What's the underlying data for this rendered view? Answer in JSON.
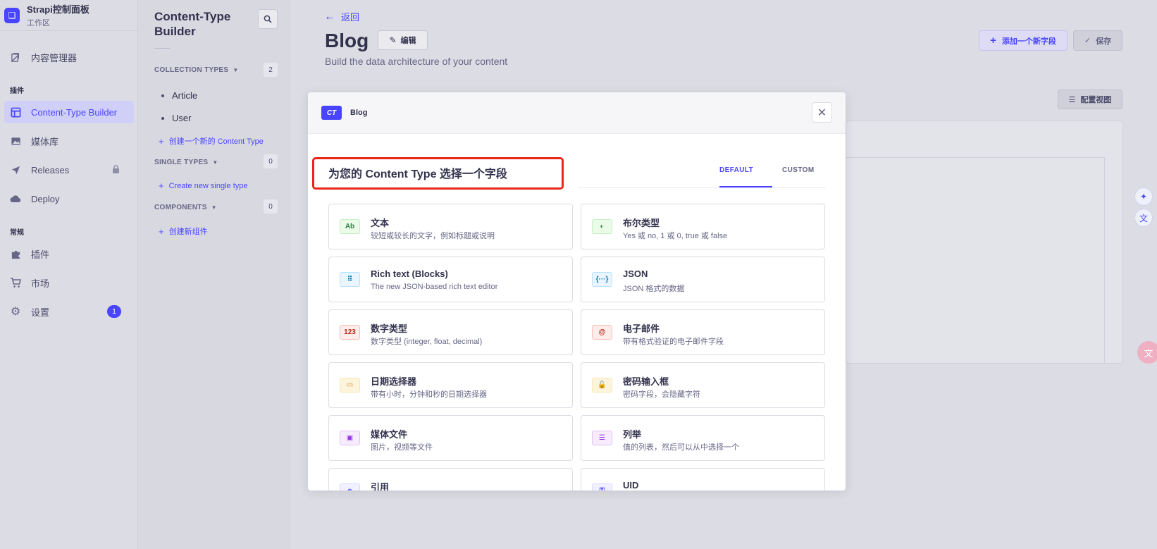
{
  "brand": {
    "logo_glyph": "❏",
    "title": "Strapi控制面板",
    "subtitle": "工作区"
  },
  "leftnav": {
    "content_manager": "内容管理器",
    "section_plugins": "插件",
    "ctb": "Content-Type Builder",
    "media": "媒体库",
    "releases": "Releases",
    "deploy": "Deploy",
    "section_general": "常规",
    "plugins": "插件",
    "marketplace": "市场",
    "settings": "设置",
    "settings_badge": "1"
  },
  "subnav": {
    "title": "Content-Type Builder",
    "collection_types": {
      "label": "COLLECTION TYPES",
      "count": "2",
      "items": [
        "Article",
        "User"
      ],
      "add": "创建一个新的 Content Type"
    },
    "single_types": {
      "label": "SINGLE TYPES",
      "count": "0",
      "add": "Create new single type"
    },
    "components": {
      "label": "COMPONENTS",
      "count": "0",
      "add": "创建新组件"
    }
  },
  "header": {
    "back": "返回",
    "title": "Blog",
    "edit": "编辑",
    "subtitle": "Build the data architecture of your content",
    "add_field": "添加一个新字段",
    "save": "保存",
    "configure_view": "配置视图"
  },
  "modal": {
    "chip": "CT",
    "name": "Blog",
    "pick_title": "为您的 Content Type 选择一个字段",
    "tab_default": "DEFAULT",
    "tab_custom": "CUSTOM",
    "fields": [
      {
        "name": "文本",
        "desc": "较短或较长的文字，例如标题或说明",
        "icon": "Ab",
        "icon_name": "text-icon",
        "bg": "#eafbe7",
        "fg": "#328048",
        "border": "#c6f0c2"
      },
      {
        "name": "布尔类型",
        "desc": "Yes 或 no, 1 或 0, true 或 false",
        "icon": "◐",
        "icon_name": "boolean-icon",
        "bg": "#eafbe7",
        "fg": "#328048",
        "border": "#c6f0c2"
      },
      {
        "name": "Rich text (Blocks)",
        "desc": "The new JSON-based rich text editor",
        "icon": "⠿",
        "icon_name": "blocks-icon",
        "bg": "#eaf5ff",
        "fg": "#0c75af",
        "border": "#b8e1ff"
      },
      {
        "name": "JSON",
        "desc": "JSON 格式的数据",
        "icon": "{···}",
        "icon_name": "json-icon",
        "bg": "#eaf5ff",
        "fg": "#0c75af",
        "border": "#b8e1ff"
      },
      {
        "name": "数字类型",
        "desc": "数字类型 (integer, float, decimal)",
        "icon": "123",
        "icon_name": "number-icon",
        "bg": "#fcecea",
        "fg": "#b72b1a",
        "border": "#f5c0b8"
      },
      {
        "name": "电子邮件",
        "desc": "带有格式验证的电子邮件字段",
        "icon": "@",
        "icon_name": "email-icon",
        "bg": "#fcecea",
        "fg": "#b72b1a",
        "border": "#f5c0b8"
      },
      {
        "name": "日期选择器",
        "desc": "带有小时，分钟和秒的日期选择器",
        "icon": "▭",
        "icon_name": "calendar-icon",
        "bg": "#fdf4dc",
        "fg": "#d9822f",
        "border": "#fae7b9"
      },
      {
        "name": "密码输入框",
        "desc": "密码字段，会隐藏字符",
        "icon": "🔓",
        "icon_name": "lock-icon",
        "bg": "#fdf4dc",
        "fg": "#d9822f",
        "border": "#fae7b9"
      },
      {
        "name": "媒体文件",
        "desc": "图片，视频等文件",
        "icon": "▣",
        "icon_name": "media-icon",
        "bg": "#f6ecfc",
        "fg": "#9736e8",
        "border": "#e0c1f4"
      },
      {
        "name": "列举",
        "desc": "值的列表，然后可以从中选择一个",
        "icon": "☰",
        "icon_name": "enumeration-icon",
        "bg": "#f6ecfc",
        "fg": "#9736e8",
        "border": "#e0c1f4"
      },
      {
        "name": "引用",
        "desc": "",
        "icon": "⚭",
        "icon_name": "relation-icon",
        "bg": "#f0f0ff",
        "fg": "#4945ff",
        "border": "#d9d8ff"
      },
      {
        "name": "UID",
        "desc": "",
        "icon": "⚿",
        "icon_name": "key-icon",
        "bg": "#f0f0ff",
        "fg": "#4945ff",
        "border": "#d9d8ff"
      }
    ]
  },
  "colors": {
    "primary": "#4945ff",
    "highlight": "#e8261b"
  }
}
